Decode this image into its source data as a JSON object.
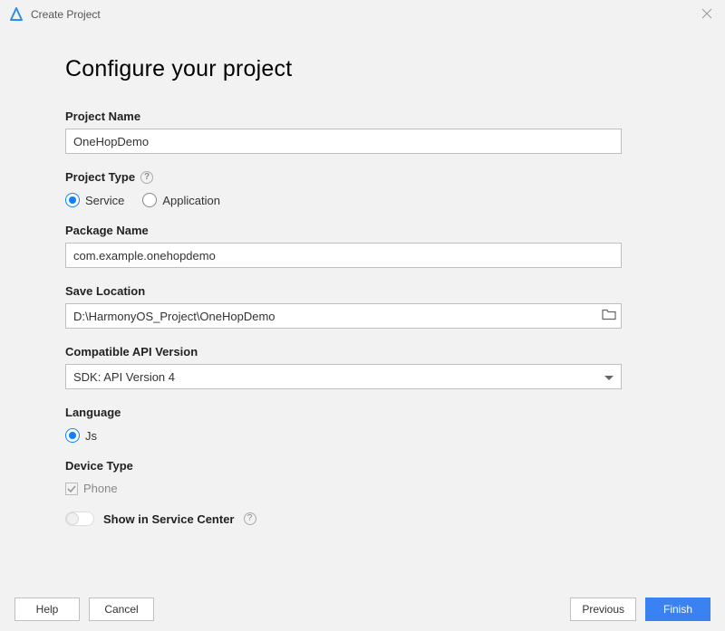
{
  "window": {
    "title": "Create Project"
  },
  "heading": "Configure your project",
  "labels": {
    "projectName": "Project Name",
    "projectType": "Project Type",
    "packageName": "Package Name",
    "saveLocation": "Save Location",
    "apiVersion": "Compatible API Version",
    "language": "Language",
    "deviceType": "Device Type",
    "showServiceCenter": "Show in Service Center"
  },
  "values": {
    "projectName": "OneHopDemo",
    "packageName": "com.example.onehopdemo",
    "saveLocation": "D:\\HarmonyOS_Project\\OneHopDemo",
    "apiVersion": "SDK: API Version 4"
  },
  "projectType": {
    "options": [
      "Service",
      "Application"
    ],
    "selected": "Service"
  },
  "language": {
    "options": [
      "Js"
    ],
    "selected": "Js"
  },
  "deviceType": {
    "option": "Phone",
    "checked": true,
    "disabled": true
  },
  "showServiceCenter": {
    "enabled": false
  },
  "buttons": {
    "help": "Help",
    "cancel": "Cancel",
    "previous": "Previous",
    "finish": "Finish"
  }
}
